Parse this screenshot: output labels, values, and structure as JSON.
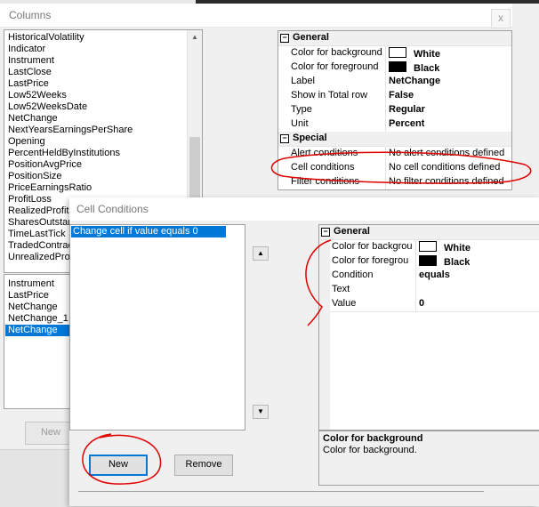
{
  "columns_window": {
    "title": "Columns",
    "close_glyph": "x",
    "available_columns": [
      "HistoricalVolatility",
      "Indicator",
      "Instrument",
      "LastClose",
      "LastPrice",
      "Low52Weeks",
      "Low52WeeksDate",
      "NetChange",
      "NextYearsEarningsPerShare",
      "Opening",
      "PercentHeldByInstitutions",
      "PositionAvgPrice",
      "PositionSize",
      "PriceEarningsRatio",
      "ProfitLoss",
      "RealizedProfitL",
      "SharesOutstan",
      "TimeLastTick",
      "TradedContrac",
      "UnrealizedProf"
    ],
    "selected_columns": [
      "Instrument",
      "LastPrice",
      "NetChange",
      "NetChange_1",
      "NetChange"
    ],
    "selected_index": 4,
    "new_button_label": "New",
    "properties": {
      "general": {
        "label": "General",
        "expand_glyph": "⊟",
        "rows": [
          {
            "name": "Color for background",
            "value": "White",
            "swatch": "#ffffff"
          },
          {
            "name": "Color for foreground",
            "value": "Black",
            "swatch": "#000000"
          },
          {
            "name": "Label",
            "value": "NetChange"
          },
          {
            "name": "Show in Total row",
            "value": "False"
          },
          {
            "name": "Type",
            "value": "Regular"
          },
          {
            "name": "Unit",
            "value": "Percent"
          }
        ]
      },
      "special": {
        "label": "Special",
        "expand_glyph": "⊟",
        "rows": [
          {
            "name": "Alert conditions",
            "value": "No alert conditions defined"
          },
          {
            "name": "Cell conditions",
            "value": "No cell conditions defined"
          },
          {
            "name": "Filter conditions",
            "value": "No filter conditions defined"
          }
        ]
      }
    }
  },
  "cell_conditions_dialog": {
    "title": "Cell Conditions",
    "conditions": [
      "Change cell if value equals 0"
    ],
    "move_up_glyph": "▲",
    "move_down_glyph": "▼",
    "new_button_label": "New",
    "remove_button_label": "Remove",
    "properties": {
      "general": {
        "label": "General",
        "expand_glyph": "⊟",
        "rows": [
          {
            "name": "Color for backgrou",
            "value": "White",
            "swatch": "#ffffff"
          },
          {
            "name": "Color for foregrou",
            "value": "Black",
            "swatch": "#000000"
          },
          {
            "name": "Condition",
            "value": "equals"
          },
          {
            "name": "Text",
            "value": ""
          },
          {
            "name": "Value",
            "value": "0"
          }
        ]
      }
    },
    "help": {
      "title": "Color for background",
      "description": "Color for background."
    }
  },
  "colors": {
    "selection": "#0078d7",
    "annotation": "#e00000",
    "category_bg": "#f0f0f0"
  }
}
